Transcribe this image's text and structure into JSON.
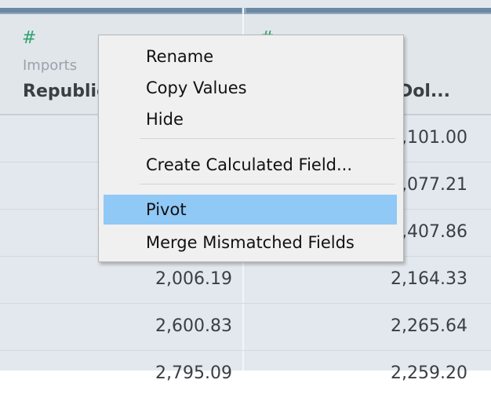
{
  "columns": [
    {
      "type_icon": "#",
      "type_label": "Imports",
      "name": "Republic"
    },
    {
      "type_icon": "#",
      "type_label": "",
      "name": "Dol..."
    }
  ],
  "rows": [
    {
      "c1": "",
      "c2": ",101.00"
    },
    {
      "c1": "",
      "c2": ",077.21"
    },
    {
      "c1": "",
      "c2": ",407.86"
    },
    {
      "c1": "2,006.19",
      "c2": "2,164.33"
    },
    {
      "c1": "2,600.83",
      "c2": "2,265.64"
    },
    {
      "c1": "2,795.09",
      "c2": "2,259.20"
    }
  ],
  "menu": {
    "items": [
      {
        "label": "Rename"
      },
      {
        "label": "Copy Values"
      },
      {
        "label": "Hide"
      },
      {
        "label": "Create Calculated Field..."
      },
      {
        "label": "Pivot",
        "active": true
      },
      {
        "label": "Merge Mismatched Fields"
      }
    ]
  },
  "colors": {
    "accent_highlight": "#90c8f6",
    "number_icon": "#2fa36b"
  }
}
